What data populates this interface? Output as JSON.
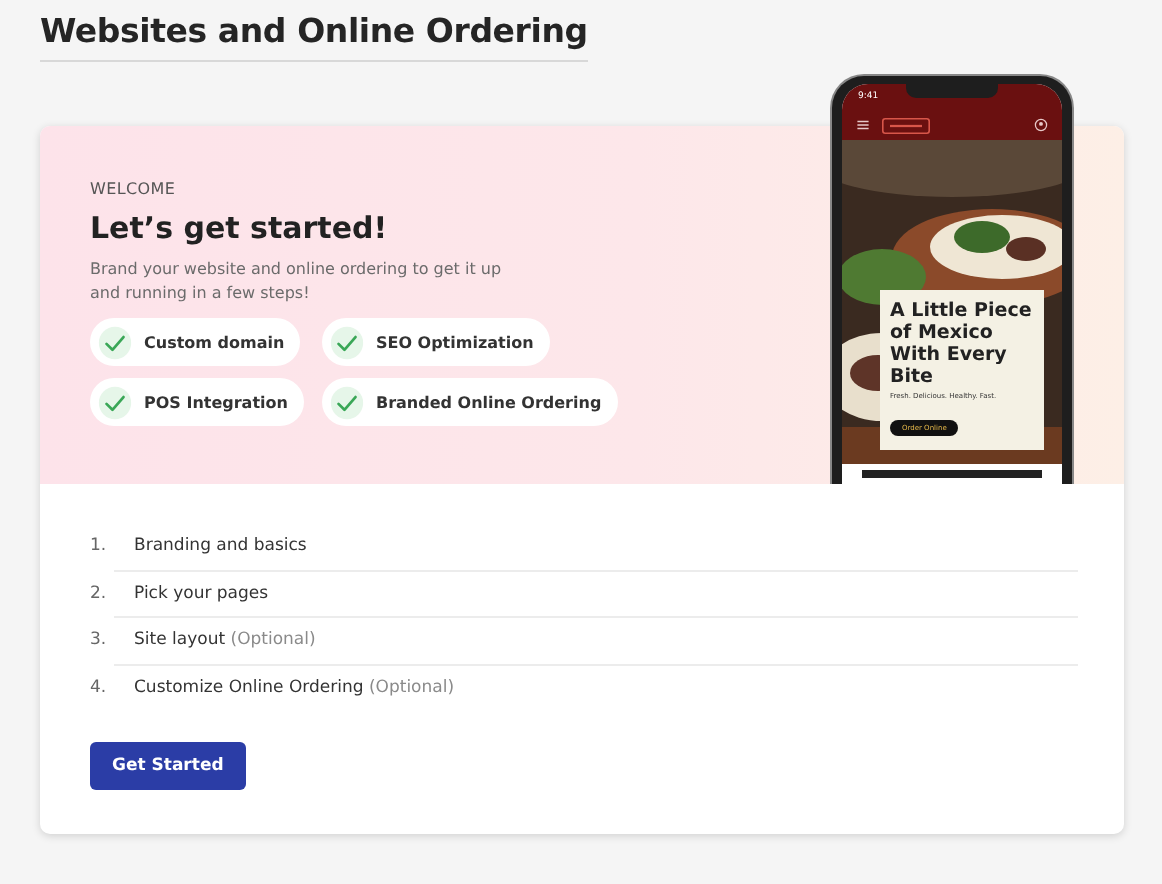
{
  "page_title": "Websites and Online Ordering",
  "hero": {
    "eyebrow": "WELCOME",
    "heading": "Let’s get started!",
    "description": "Brand your website and online ordering to get it up and running in a few steps!",
    "features": [
      {
        "label": "Custom domain",
        "checked": true
      },
      {
        "label": "SEO Optimization",
        "checked": true
      },
      {
        "label": "POS Integration",
        "checked": true
      },
      {
        "label": "Branded Online Ordering",
        "checked": true
      }
    ]
  },
  "phone": {
    "time": "9:41",
    "headline": "A Little Piece of Mexico With Every Bite",
    "tagline": "Fresh. Delicious. Healthy. Fast.",
    "button": "Order Online"
  },
  "steps": [
    {
      "number": "1.",
      "label": "Branding and basics"
    },
    {
      "number": "2.",
      "label": "Pick your pages"
    },
    {
      "number": "3.",
      "label": "Site layout",
      "note": "(Optional)"
    },
    {
      "number": "4.",
      "label": "Customize Online Ordering",
      "note": "(Optional)"
    }
  ],
  "primary_button": "Get Started"
}
